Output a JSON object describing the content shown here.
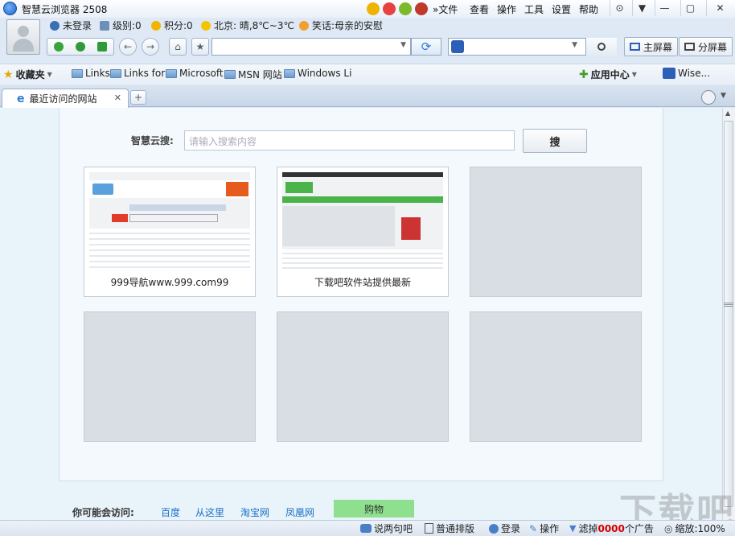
{
  "app": {
    "title": "智慧云浏览器 2508"
  },
  "menu": [
    "»文件",
    "查看",
    "操作",
    "工具",
    "设置",
    "帮助"
  ],
  "user": {
    "login": "未登录",
    "level": "级别:0",
    "points": "积分:0",
    "weather": "北京: 晴,8℃~3℃",
    "joke": "笑话:母亲的安慰"
  },
  "nav": {
    "address_value": "",
    "search_value": "",
    "main_screen": "主屏幕",
    "split_screen": "分屏幕"
  },
  "bookmarks": {
    "label": "收藏夹",
    "items": [
      "Links",
      "Links for",
      "Microsoft",
      "MSN 网站",
      "Windows Li"
    ],
    "app_center": "应用中心",
    "wise": "Wise..."
  },
  "tabs": [
    {
      "label": "最近访问的网站"
    }
  ],
  "search": {
    "label": "智慧云搜:",
    "placeholder": "请输入搜索内容",
    "button": "搜"
  },
  "tiles": [
    {
      "caption": "999导航www.999.com99"
    },
    {
      "caption": "下载吧软件站提供最新"
    },
    {
      "caption": ""
    },
    {
      "caption": ""
    },
    {
      "caption": ""
    },
    {
      "caption": ""
    }
  ],
  "suggestions": {
    "label": "你可能会访问:",
    "items": [
      "百度",
      "从这里",
      "淘宝网",
      "凤凰网",
      "购物"
    ]
  },
  "status": {
    "chat": "说两句吧",
    "layout": "普通排版",
    "login": "登录",
    "ops": "操作",
    "filter_prefix": "滤掉",
    "filter_count": "0000",
    "filter_suffix": "个广告",
    "zoom": "缩放:100%"
  },
  "colors": {
    "accent": "#2b7bd6",
    "ad_count": "#d00000"
  },
  "watermark": "下载吧"
}
